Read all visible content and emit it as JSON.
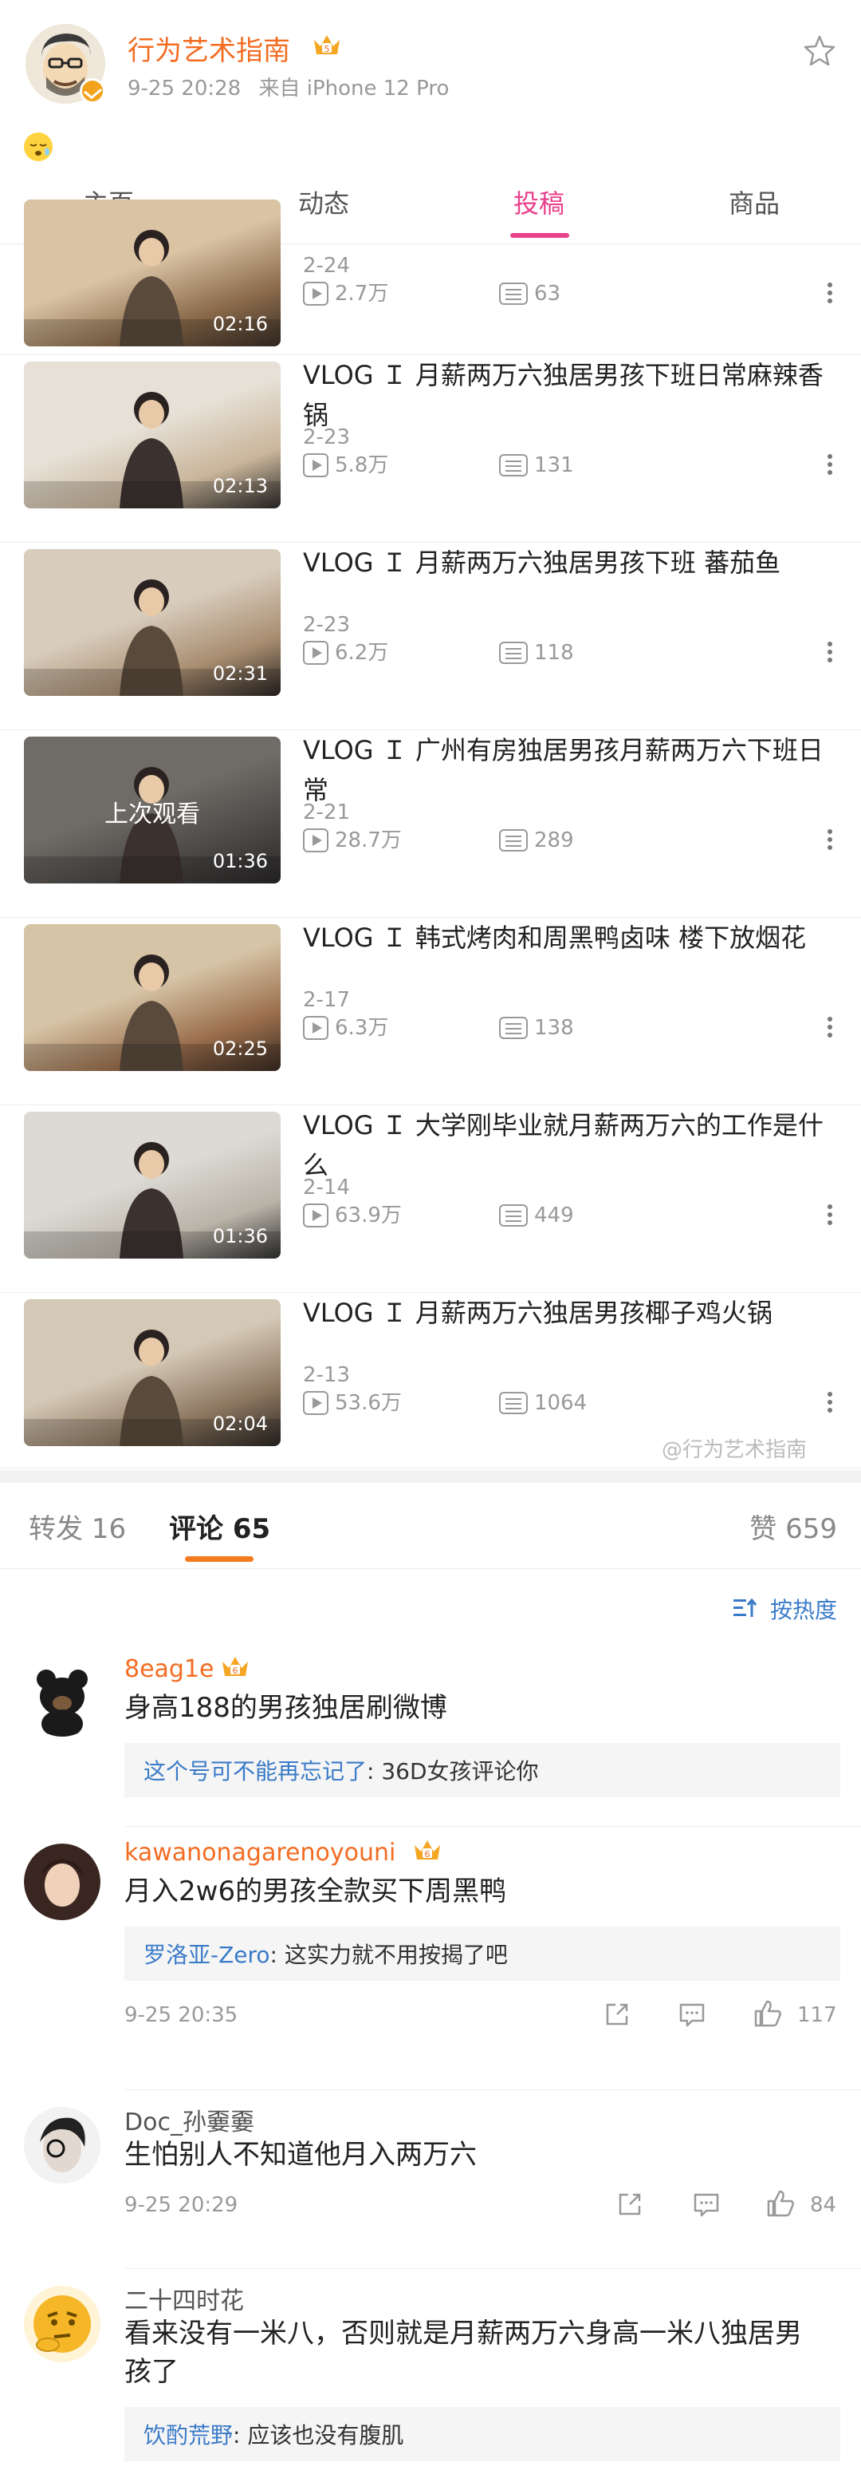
{
  "header": {
    "user_name": "行为艺术指南",
    "post_time": "9-25 20:28",
    "post_source": "来自 iPhone 12 Pro",
    "star_icon": "star-outline-icon",
    "emoji": "sleepy-face-emoji"
  },
  "tabs": [
    "主页",
    "动态",
    "投稿",
    "商品"
  ],
  "active_tab": "投稿",
  "videos": [
    {
      "title": "",
      "date": "2-24",
      "views": "2.7万",
      "danmaku": "63",
      "duration": "02:16",
      "last_watched": ""
    },
    {
      "title": "VLOG Ｉ 月薪两万六独居男孩下班日常麻辣香锅",
      "date": "2-23",
      "views": "5.8万",
      "danmaku": "131",
      "duration": "02:13",
      "last_watched": ""
    },
    {
      "title": "VLOG Ｉ 月薪两万六独居男孩下班  蕃茄鱼",
      "date": "2-23",
      "views": "6.2万",
      "danmaku": "118",
      "duration": "02:31",
      "last_watched": ""
    },
    {
      "title": "VLOG Ｉ 广州有房独居男孩月薪两万六下班日常",
      "date": "2-21",
      "views": "28.7万",
      "danmaku": "289",
      "duration": "01:36",
      "last_watched": "上次观看"
    },
    {
      "title": "VLOG Ｉ 韩式烤肉和周黑鸭卤味  楼下放烟花",
      "date": "2-17",
      "views": "6.3万",
      "danmaku": "138",
      "duration": "02:25",
      "last_watched": ""
    },
    {
      "title": "VLOG Ｉ 大学刚毕业就月薪两万六的工作是什么",
      "date": "2-14",
      "views": "63.9万",
      "danmaku": "449",
      "duration": "01:36",
      "last_watched": ""
    },
    {
      "title": "VLOG Ｉ 月薪两万六独居男孩椰子鸡火锅",
      "date": "2-13",
      "views": "53.6万",
      "danmaku": "1064",
      "duration": "02:04",
      "last_watched": ""
    }
  ],
  "watermark": "@行为艺术指南",
  "comment_tabs": {
    "repost": "转发 16",
    "comment": "评论 65",
    "like": "赞 659"
  },
  "sort_label": "按热度",
  "comments": [
    {
      "name": "8eag1e",
      "name_color": "#f36c21",
      "text": "身高188的男孩独居刷微博",
      "reply_name": "这个号可不能再忘记了",
      "reply_text": ": 36D女孩评论你",
      "time": "",
      "likes": ""
    },
    {
      "name": "kawanonagarenoyouni",
      "name_color": "#f36c21",
      "text": "月入2w6的男孩全款买下周黑鸭",
      "reply_name": "罗洛亚-Zero",
      "reply_text": ": 这实力就不用按揭了吧",
      "time": "9-25 20:35",
      "likes": "117"
    },
    {
      "name": "Doc_孙嫑嫑",
      "name_color": "#555555",
      "text": "生怕别人不知道他月入两万六",
      "reply_name": "",
      "reply_text": "",
      "time": "9-25 20:29",
      "likes": "84"
    },
    {
      "name": "二十四时花",
      "name_color": "#555555",
      "text": "看来没有一米八，否则就是月薪两万六身高一米八独居男孩了",
      "reply_name": "饮酌荒野",
      "reply_text": ": 应该也没有腹肌",
      "time": "",
      "likes": ""
    }
  ]
}
